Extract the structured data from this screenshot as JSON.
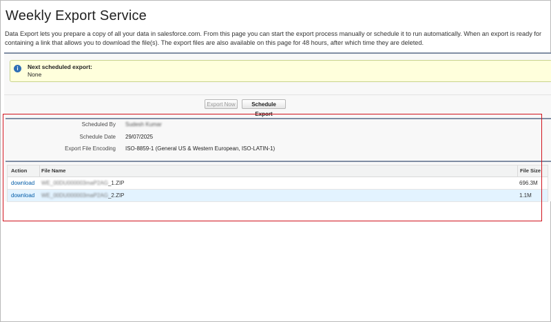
{
  "page": {
    "title": "Weekly Export Service",
    "description_lines": [
      "Data Export lets you prepare a copy of all your data in salesforce.com. From this page you can start the export process manually or schedule it to run automatically. When an export is ready for",
      "containing a link that allows you to download the file(s). The export files are also available on this page for 48 hours, after which time they are deleted."
    ]
  },
  "notice": {
    "title": "Next scheduled export:",
    "value": "None",
    "icon": "info-icon"
  },
  "buttons": {
    "export_now": "Export Now",
    "schedule_export": "Schedule Export"
  },
  "details": {
    "scheduled_by_label": "Scheduled By",
    "scheduled_by_value": "Sudesh Kumar",
    "schedule_date_label": "Schedule Date",
    "schedule_date_value": "29/07/2025",
    "encoding_label": "Export File Encoding",
    "encoding_value": "ISO-8859-1 (General US & Western European, ISO-LATIN-1)"
  },
  "table": {
    "headers": {
      "action": "Action",
      "file_name": "File Name",
      "file_size": "File Size"
    },
    "rows": [
      {
        "action": "download",
        "file_prefix": "WE_00DU000003maP2AG",
        "file_suffix": "_1.ZIP",
        "size": "696.3M"
      },
      {
        "action": "download",
        "file_prefix": "WE_00DU000003maP2AG",
        "file_suffix": "_2.ZIP",
        "size": "1.1M"
      }
    ]
  },
  "colors": {
    "notice_background": "#ffffdc",
    "section_rule": "#7f8da3",
    "link": "#015ba7",
    "highlight_border": "#d0101a",
    "alt_row": "#e3f3ff"
  }
}
